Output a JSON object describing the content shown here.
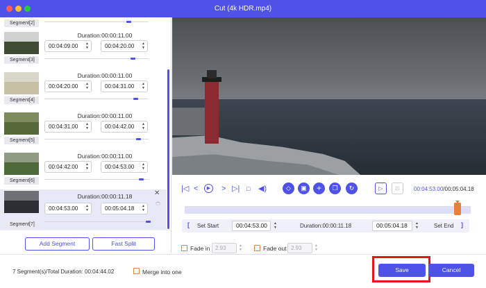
{
  "window": {
    "title": "Cut (4k HDR.mp4)"
  },
  "top_partial": {
    "label": "Segment[2]"
  },
  "segments": [
    {
      "label": "Segment[3]",
      "duration": "Duration:00:00:11.00",
      "start": "00:04:09.00",
      "end": "00:04:20.00"
    },
    {
      "label": "Segment[4]",
      "duration": "Duration:00:00:11.00",
      "start": "00:04:20.00",
      "end": "00:04:31.00"
    },
    {
      "label": "Segment[5]",
      "duration": "Duration:00:00:11.00",
      "start": "00:04:31.00",
      "end": "00:04:42.00"
    },
    {
      "label": "Segment[6]",
      "duration": "Duration:00:00:11.00",
      "start": "00:04:42.00",
      "end": "00:04:53.00"
    },
    {
      "label": "Segment[7]",
      "duration": "Duration:00:00:11.18",
      "start": "00:04:53.00",
      "end": "00:05:04.18"
    }
  ],
  "buttons": {
    "add_segment": "Add Segment",
    "fast_split": "Fast Split",
    "save": "Save",
    "cancel": "Cancel"
  },
  "player": {
    "current_time": "00:04:53.00",
    "total_time": "/00:05:04.18"
  },
  "setrow": {
    "set_start": "Set Start",
    "start": "00:04:53.00",
    "duration": "Duration:00:00:11.18",
    "end": "00:05:04.18",
    "set_end": "Set End"
  },
  "fade": {
    "fade_in_label": "Fade in",
    "fade_in_value": "2.93",
    "fade_out_label": "Fade out",
    "fade_out_value": "2.93"
  },
  "footer": {
    "summary": "7 Segment(s)/Total Duration: 00:04:44.02",
    "merge_label": "Merge into one"
  },
  "colors": {
    "accent": "#4f52e6",
    "highlight": "#e3161b",
    "orange": "#e87f3a"
  }
}
